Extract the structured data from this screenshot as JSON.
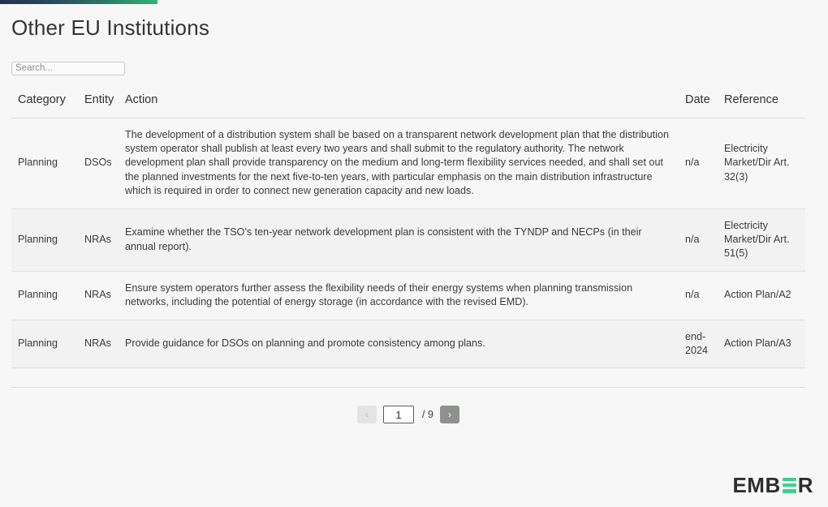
{
  "progress": {
    "name": "page-load-progress",
    "percent": 19,
    "gradient_start": "#22304f",
    "gradient_end": "#2fb574"
  },
  "header": {
    "title": "Other EU Institutions"
  },
  "search": {
    "placeholder": "Search...",
    "value": ""
  },
  "table": {
    "columns": [
      {
        "key": "category",
        "label": "Category"
      },
      {
        "key": "entity",
        "label": "Entity"
      },
      {
        "key": "action",
        "label": "Action"
      },
      {
        "key": "date",
        "label": "Date"
      },
      {
        "key": "reference",
        "label": "Reference"
      }
    ],
    "rows": [
      {
        "category": "Planning",
        "entity": "DSOs",
        "action": "The development of a distribution system shall be based on a transparent network development plan that the distribution system operator shall publish at least every two years and shall submit to the regulatory authority. The network development plan shall provide transparency on the medium and long-term flexibility services needed, and shall set out the planned investments for the next five-to-ten years, with particular emphasis on the main distribution infrastructure which is required in order to connect new generation capacity and new loads.",
        "date": "n/a",
        "reference": "Electricity Market/Dir Art. 32(3)"
      },
      {
        "category": "Planning",
        "entity": "NRAs",
        "action": "Examine whether the TSO's ten-year network development plan is consistent with the TYNDP and NECPs (in their annual report).",
        "date": "n/a",
        "reference": "Electricity Market/Dir Art. 51(5)"
      },
      {
        "category": "Planning",
        "entity": "NRAs",
        "action": "Ensure system operators further assess the flexibility needs of their energy systems when planning transmission networks, including the potential of energy storage (in accordance with the revised EMD).",
        "date": "n/a",
        "reference": "Action Plan/A2"
      },
      {
        "category": "Planning",
        "entity": "NRAs",
        "action": "Provide guidance for DSOs on planning and promote consistency among plans.",
        "date": "end-2024",
        "reference": "Action Plan/A3"
      }
    ]
  },
  "pagination": {
    "prev_label": "‹",
    "next_label": "›",
    "current_page": "1",
    "total_label": "/ 9",
    "total_pages": 9
  },
  "footer": {
    "logo_part1": "EMB",
    "logo_part2": "R",
    "logo_icon": "ember-e-bars-icon",
    "accent_color": "#3ecf8e"
  }
}
